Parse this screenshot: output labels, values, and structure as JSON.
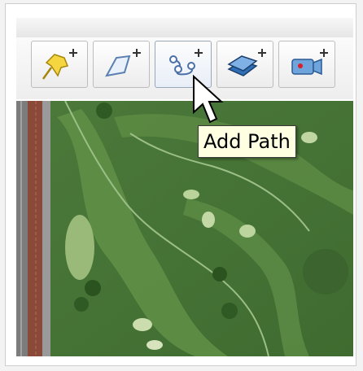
{
  "toolbar": {
    "buttons": [
      {
        "name": "add-placemark-button",
        "icon": "pushpin-plus-icon",
        "active": false
      },
      {
        "name": "add-polygon-button",
        "icon": "polygon-plus-icon",
        "active": false
      },
      {
        "name": "add-path-button",
        "icon": "path-plus-icon",
        "active": true
      },
      {
        "name": "add-image-overlay-button",
        "icon": "image-overlay-plus-icon",
        "active": false
      },
      {
        "name": "record-tour-button",
        "icon": "camera-plus-icon",
        "active": false
      }
    ]
  },
  "tooltip": {
    "text": "Add Path"
  },
  "map": {
    "grass_color": "#4f7a3a",
    "fairway_color": "#5e8c45"
  },
  "colors": {
    "tooltip_bg": "#ffffe1",
    "active_button_border": "#9aa7b8"
  }
}
